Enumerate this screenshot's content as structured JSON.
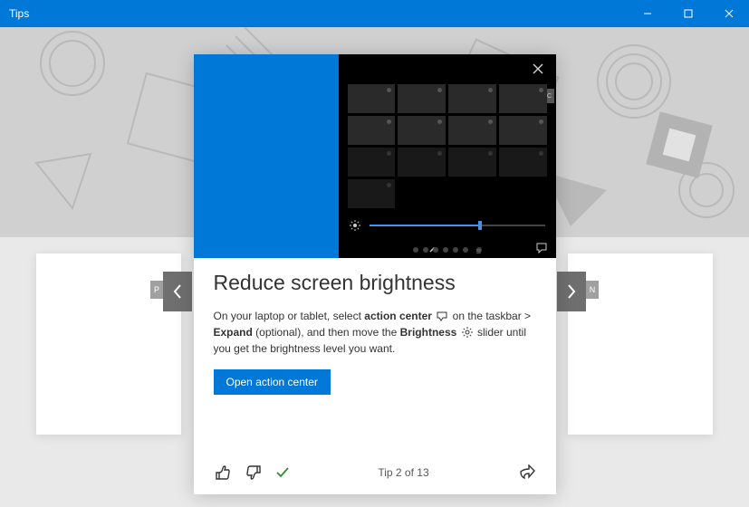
{
  "window": {
    "title": "Tips"
  },
  "card": {
    "title": "Reduce screen brightness",
    "body": {
      "p1": "On your laptop or tablet, select ",
      "b1": "action center",
      "p2": " on the taskbar > ",
      "b2": "Expand",
      "p3": " (optional), and then move the ",
      "b3": "Brightness",
      "p4": " slider until you get the brightness level you want."
    },
    "action_button": "Open action center"
  },
  "footer": {
    "counter": "Tip 2 of 13"
  },
  "nav": {
    "prev_letter": "P",
    "next_letter": "N"
  },
  "illustration": {
    "c_label": "C"
  }
}
